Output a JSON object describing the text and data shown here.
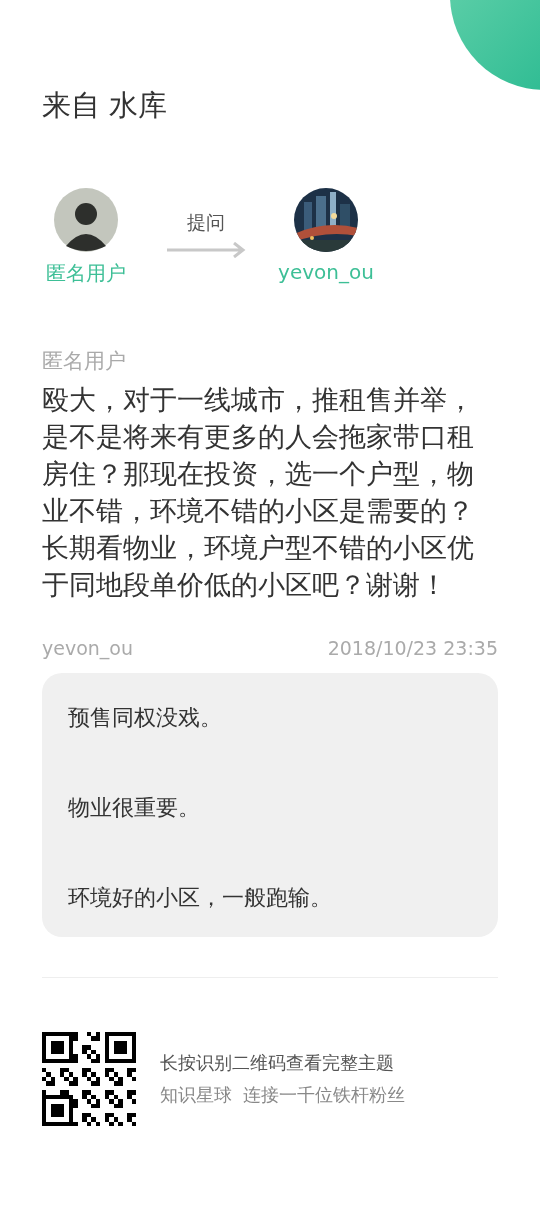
{
  "title": "来自 水库",
  "asker": {
    "name": "匿名用户"
  },
  "action": "提问",
  "answerer": {
    "name": "yevon_ou"
  },
  "question": {
    "author": "匿名用户",
    "text": "殴大，对于一线城市，推租售并举，是不是将来有更多的人会拖家带口租房住？那现在投资，选一个户型，物业不错，环境不错的小区是需要的？长期看物业，环境户型不错的小区优于同地段单价低的小区吧？谢谢！"
  },
  "answer": {
    "author": "yevon_ou",
    "time": "2018/10/23 23:35",
    "paragraphs": [
      "预售同权没戏。",
      "物业很重要。",
      "环境好的小区，一般跑输。"
    ]
  },
  "footer": {
    "line_1": "长按识别二维码查看完整主题",
    "line_2": "知识星球  连接一千位铁杆粉丝"
  }
}
